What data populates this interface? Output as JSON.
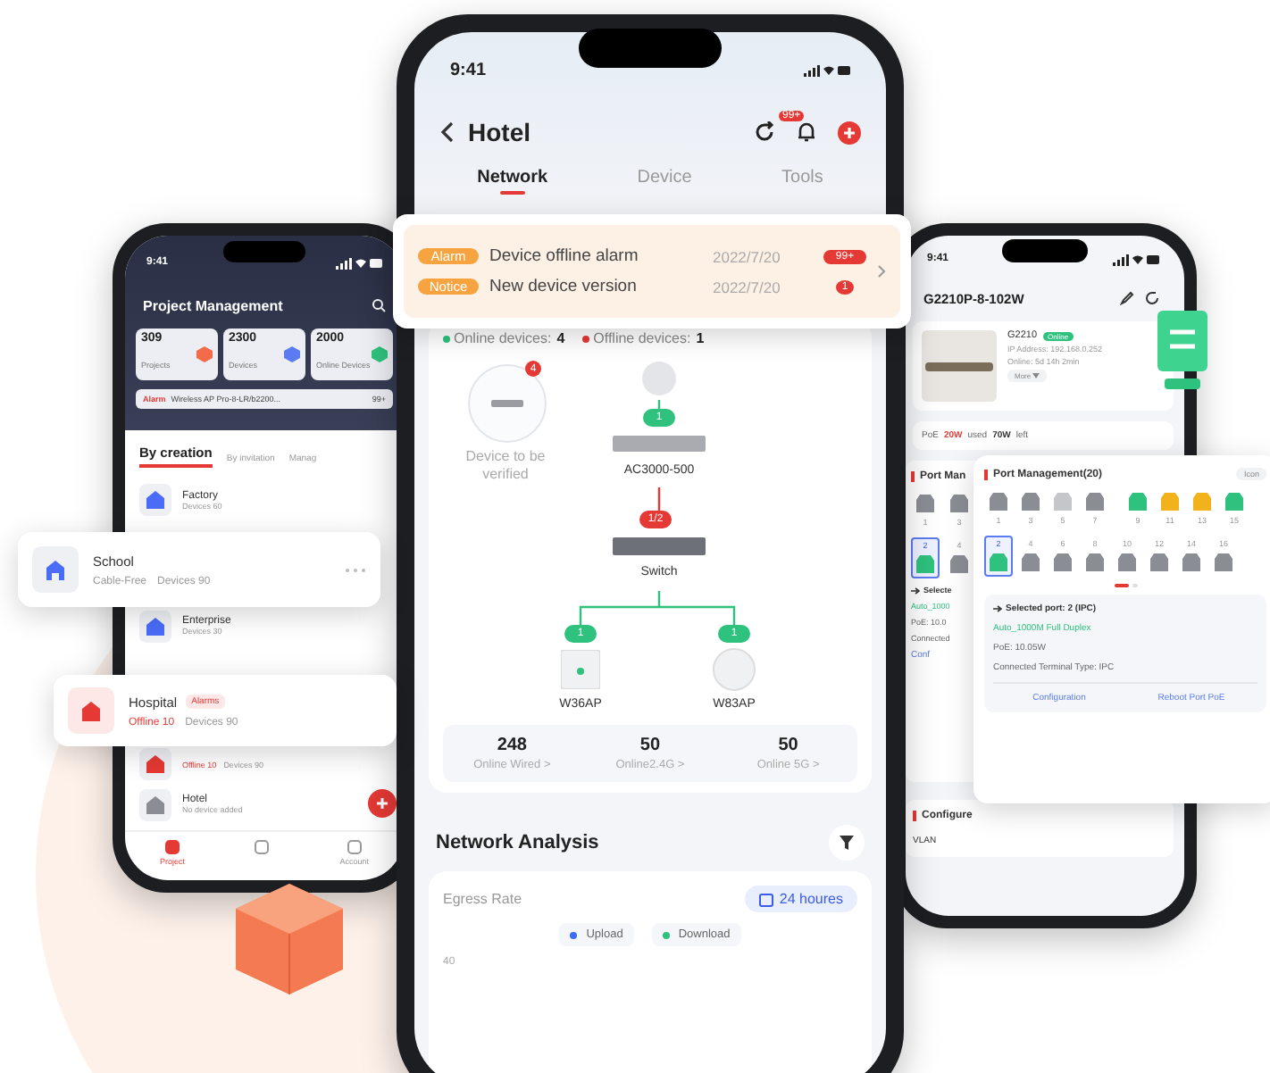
{
  "left_phone": {
    "time": "9:41",
    "title": "Project Management",
    "stats": [
      {
        "value": "309",
        "label": "Projects",
        "color": "#f36b4a"
      },
      {
        "value": "2300",
        "label": "Devices",
        "color": "#5b7cf0"
      },
      {
        "value": "2000",
        "label": "Online Devices",
        "color": "#2ec27e"
      }
    ],
    "alarm": {
      "tag": "Alarm",
      "text": "Wireless AP Pro-8-LR/b2200...",
      "count": "99+"
    },
    "tabs": [
      {
        "label": "By creation",
        "selected": true
      },
      {
        "label": "By invitation",
        "selected": false
      },
      {
        "label": "Manag",
        "selected": false
      }
    ],
    "projects": [
      {
        "name": "Factory",
        "detail": "Devices 60",
        "color": "#4a6cf7"
      },
      {
        "name": "Enterprise",
        "detail": "Devices 30",
        "color": "#4a6cf7"
      },
      {
        "detail": "Devices 90",
        "offline": "Offline 10",
        "color": "#e53935"
      },
      {
        "name": "Hotel",
        "detail": "No device added",
        "color": "#8a8d93"
      }
    ],
    "nav": [
      {
        "label": "Project",
        "selected": true
      },
      {
        "selected": false
      },
      {
        "label": "Account",
        "selected": false
      }
    ]
  },
  "school_card": {
    "name": "School",
    "tags": [
      "Cable-Free",
      "Devices 90"
    ]
  },
  "hospital_card": {
    "name": "Hospital",
    "badge": "Alarms",
    "offline": "Offline 10",
    "devices": "Devices 90"
  },
  "center_phone": {
    "time": "9:41",
    "title": "Hotel",
    "badge": "99+",
    "tabs": [
      {
        "label": "Network",
        "selected": true
      },
      {
        "label": "Device",
        "selected": false
      },
      {
        "label": "Tools",
        "selected": false
      }
    ],
    "messages": [
      {
        "tag": "Alarm",
        "text": "Device offline alarm",
        "date": "2022/7/20",
        "count": "99+"
      },
      {
        "tag": "Notice",
        "text": "New device version",
        "date": "2022/7/20",
        "count": "1"
      }
    ],
    "status": [
      {
        "label": "Online devices:",
        "value": "4",
        "color": "#2ec27e"
      },
      {
        "label": "Offline devices:",
        "value": "1",
        "color": "#e53935"
      }
    ],
    "verify": {
      "label": "Device to be verified",
      "count": "4"
    },
    "topology": {
      "uplink": "1",
      "controller": "AC3000-500",
      "switch_link": "1/2",
      "switch": "Switch",
      "ap_links": [
        "1",
        "1"
      ],
      "aps": [
        "W36AP",
        "W83AP"
      ]
    },
    "counters": [
      {
        "value": "248",
        "label": "Online Wired >"
      },
      {
        "value": "50",
        "label": "Online2.4G >"
      },
      {
        "value": "50",
        "label": "Online 5G >"
      }
    ],
    "analysis": {
      "title": "Network Analysis",
      "metric": "Egress Rate",
      "range": "24 houres",
      "legend": [
        {
          "label": "Upload",
          "color": "#3b6cf6"
        },
        {
          "label": "Download",
          "color": "#2ec27e"
        }
      ],
      "y_tick": "40"
    }
  },
  "right_phone": {
    "time": "9:41",
    "title": "G2210P-8-102W",
    "model": "G2210",
    "state": "Online",
    "ip": "IP Address: 192.168.0.252",
    "uptime": "Online: 5d 14h 2min",
    "more": "More",
    "poe": {
      "label": "PoE",
      "used": "20W",
      "used_text": "used",
      "left": "70W",
      "left_text": "left"
    },
    "section": "Port Man",
    "ports_top": [
      {
        "label": "1",
        "color": "#8a8d93",
        "selected": false
      },
      {
        "label": "3",
        "color": "#8a8d93",
        "selected": false
      }
    ],
    "ports_bottom": [
      {
        "label": "2",
        "color": "#2ec27e",
        "selected": true
      },
      {
        "label": "4",
        "color": "#8a8d93",
        "selected": false
      }
    ],
    "selected": "Selecte",
    "lines": [
      "Auto_1000",
      "PoE: 10.0",
      "Connected"
    ],
    "config": "Conf",
    "configure": "Configure",
    "vlan": "VLAN"
  },
  "port_card": {
    "title": "Port Management(20)",
    "icon_button": "Icon",
    "ports_top": [
      {
        "label": "1",
        "color": "#8a8d93",
        "selected": false
      },
      {
        "label": "3",
        "color": "#8a8d93",
        "selected": false
      },
      {
        "label": "5",
        "color": "#c4c6ca",
        "selected": false
      },
      {
        "label": "7",
        "color": "#8a8d93",
        "selected": false
      },
      {
        "label": "9",
        "color": "#2ec27e",
        "selected": false
      },
      {
        "label": "11",
        "color": "#f2b21c",
        "selected": false
      },
      {
        "label": "13",
        "color": "#f2b21c",
        "selected": false
      },
      {
        "label": "15",
        "color": "#2ec27e",
        "selected": false
      }
    ],
    "ports_bottom": [
      {
        "label": "2",
        "color": "#2ec27e",
        "selected": true
      },
      {
        "label": "4",
        "color": "#8a8d93",
        "selected": false
      },
      {
        "label": "6",
        "color": "#8a8d93",
        "selected": false
      },
      {
        "label": "8",
        "color": "#8a8d93",
        "selected": false
      },
      {
        "label": "10",
        "color": "#8a8d93",
        "selected": false
      },
      {
        "label": "12",
        "color": "#8a8d93",
        "selected": false
      },
      {
        "label": "14",
        "color": "#8a8d93",
        "selected": false
      },
      {
        "label": "16",
        "color": "#8a8d93",
        "selected": false
      }
    ],
    "selected_port": "Selected port: 2 (IPC)",
    "mode": "Auto_1000M Full Duplex",
    "poe": "PoE: 10.05W",
    "terminal": "Connected Terminal Type: IPC",
    "actions": [
      "Configuration",
      "Reboot Port PoE"
    ]
  }
}
